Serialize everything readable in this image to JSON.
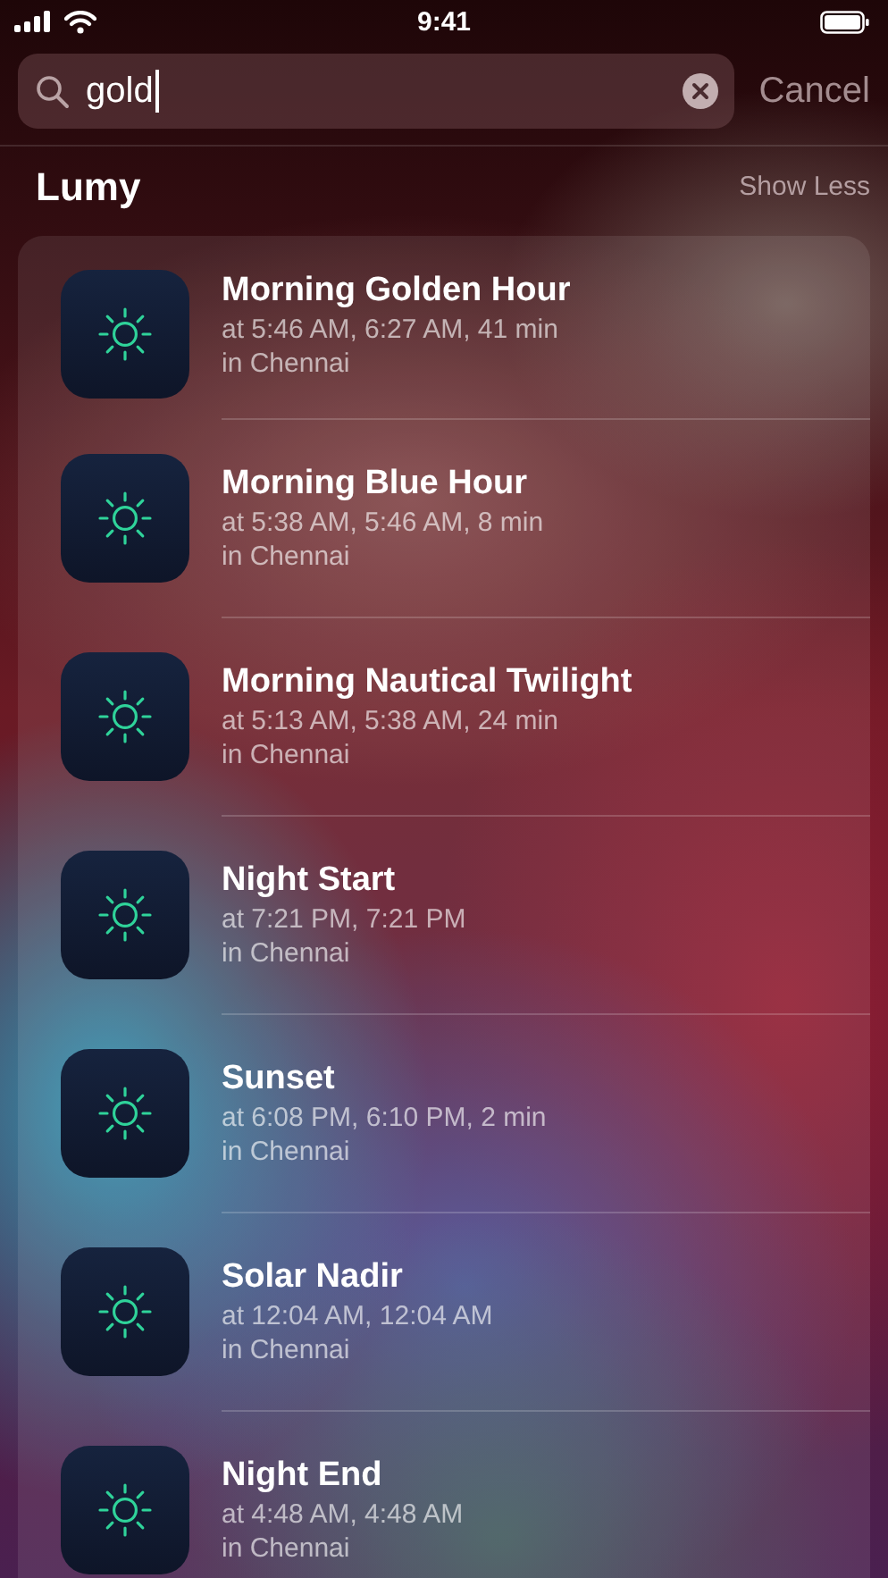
{
  "status_bar": {
    "time": "9:41"
  },
  "search": {
    "value": "gold",
    "cancel": "Cancel"
  },
  "section": {
    "title": "Lumy",
    "action": "Show Less"
  },
  "results": [
    {
      "title": "Morning Golden Hour",
      "detail": "at 5:46 AM, 6:27 AM, 41 min",
      "location": "in Chennai"
    },
    {
      "title": "Morning Blue Hour",
      "detail": "at 5:38 AM, 5:46 AM, 8 min",
      "location": "in Chennai"
    },
    {
      "title": "Morning Nautical Twilight",
      "detail": "at 5:13 AM, 5:38 AM, 24 min",
      "location": "in Chennai"
    },
    {
      "title": "Night Start",
      "detail": "at 7:21 PM, 7:21 PM",
      "location": "in Chennai"
    },
    {
      "title": "Sunset",
      "detail": "at 6:08 PM, 6:10 PM, 2 min",
      "location": "in Chennai"
    },
    {
      "title": "Solar Nadir",
      "detail": "at 12:04 AM, 12:04 AM",
      "location": "in Chennai"
    },
    {
      "title": "Night End",
      "detail": "at 4:48 AM, 4:48 AM",
      "location": "in Chennai"
    }
  ]
}
